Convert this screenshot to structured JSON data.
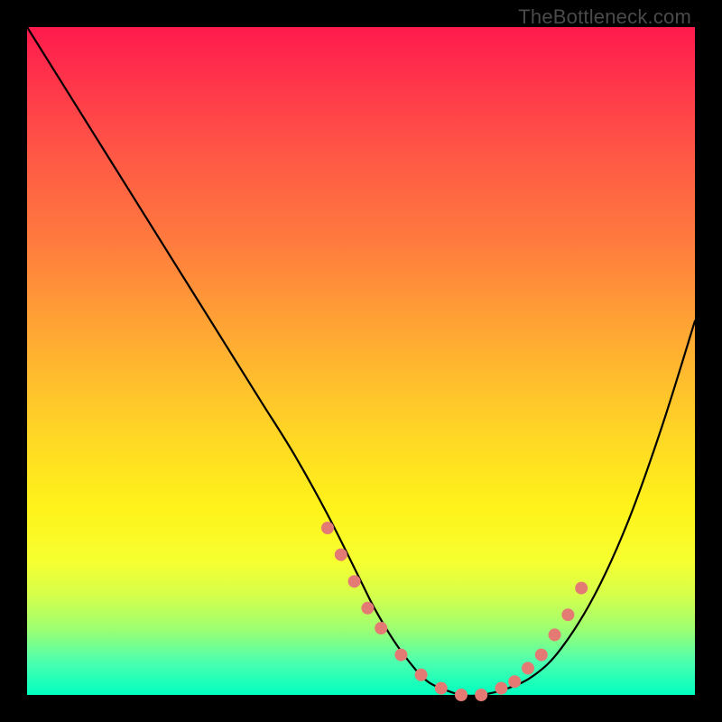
{
  "watermark": "TheBottleneck.com",
  "colors": {
    "curve_stroke": "#000000",
    "dot_fill": "#e37b74",
    "gradient_top": "#ff1a4d",
    "gradient_bottom": "#00ffc0"
  },
  "chart_data": {
    "type": "line",
    "title": "",
    "xlabel": "",
    "ylabel": "",
    "xlim": [
      0,
      100
    ],
    "ylim": [
      0,
      100
    ],
    "grid": false,
    "legend": "none",
    "series": [
      {
        "name": "bottleneck-curve",
        "x": [
          0,
          5,
          10,
          15,
          20,
          25,
          30,
          35,
          40,
          45,
          50,
          52,
          55,
          58,
          60,
          62,
          65,
          68,
          72,
          76,
          80,
          85,
          90,
          95,
          100
        ],
        "values": [
          100,
          92,
          84,
          76,
          68,
          60,
          52,
          44,
          36,
          27,
          17,
          13,
          8,
          4,
          2,
          1,
          0,
          0,
          1,
          3,
          7,
          15,
          26,
          40,
          56
        ]
      }
    ],
    "dots": {
      "name": "highlight-dots",
      "x": [
        45,
        47,
        49,
        51,
        53,
        56,
        59,
        62,
        65,
        68,
        71,
        73,
        75,
        77,
        79,
        81,
        83
      ],
      "values": [
        25,
        21,
        17,
        13,
        10,
        6,
        3,
        1,
        0,
        0,
        1,
        2,
        4,
        6,
        9,
        12,
        16
      ]
    }
  }
}
